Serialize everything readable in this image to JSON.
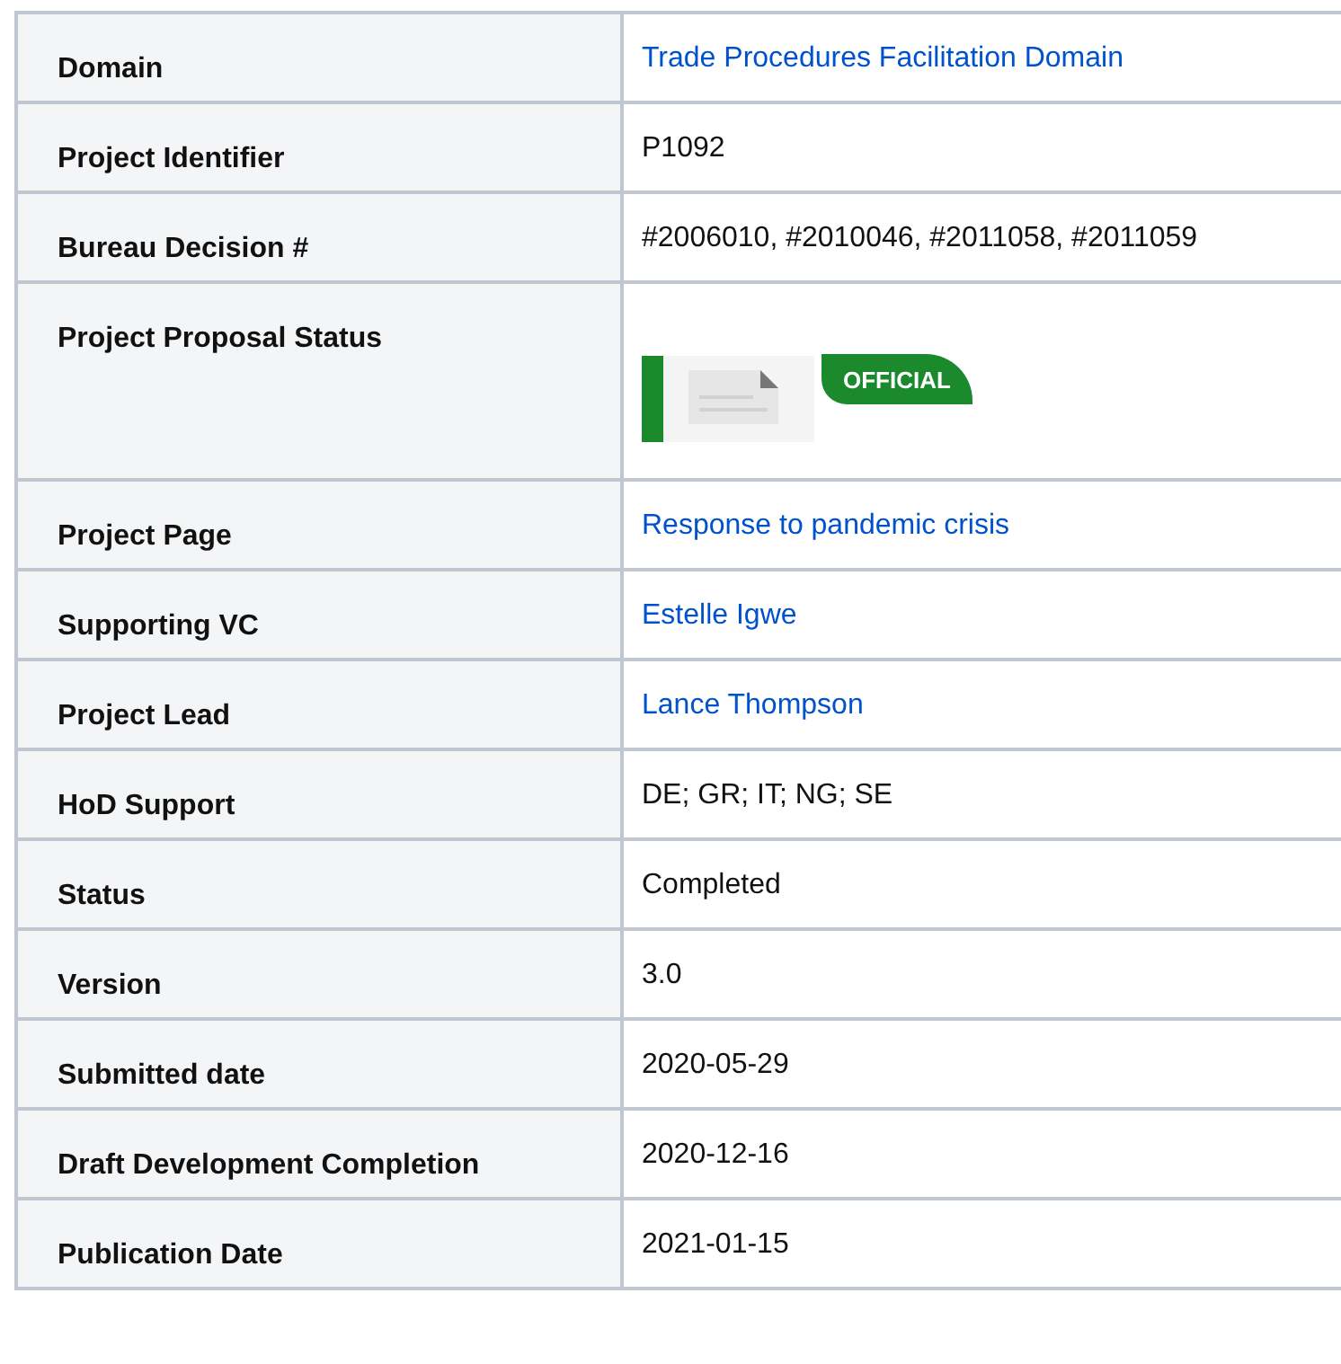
{
  "rows": [
    {
      "label": "Domain",
      "kind": "link",
      "value": "Trade Procedures Facilitation Domain"
    },
    {
      "label": "Project Identifier",
      "kind": "text",
      "value": "P1092"
    },
    {
      "label": "Bureau Decision #",
      "kind": "text",
      "value": "#2006010, #2010046, #2011058, #2011059"
    },
    {
      "label": "Project Proposal Status",
      "kind": "status",
      "value": "OFFICIAL"
    },
    {
      "label": "Project Page",
      "kind": "link",
      "value": "Response to pandemic crisis"
    },
    {
      "label": "Supporting VC",
      "kind": "link",
      "value": "Estelle Igwe"
    },
    {
      "label": "Project Lead",
      "kind": "link",
      "value": "Lance Thompson"
    },
    {
      "label": "HoD Support",
      "kind": "text",
      "value": "DE; GR; IT; NG; SE"
    },
    {
      "label": "Status",
      "kind": "text",
      "value": "Completed"
    },
    {
      "label": "Version",
      "kind": "text",
      "value": "3.0"
    },
    {
      "label": "Submitted date",
      "kind": "text",
      "value": "2020-05-29"
    },
    {
      "label": "Draft Development Completion",
      "kind": "text",
      "value": "2020-12-16"
    },
    {
      "label": "Publication Date",
      "kind": "text",
      "value": "2021-01-15"
    }
  ]
}
